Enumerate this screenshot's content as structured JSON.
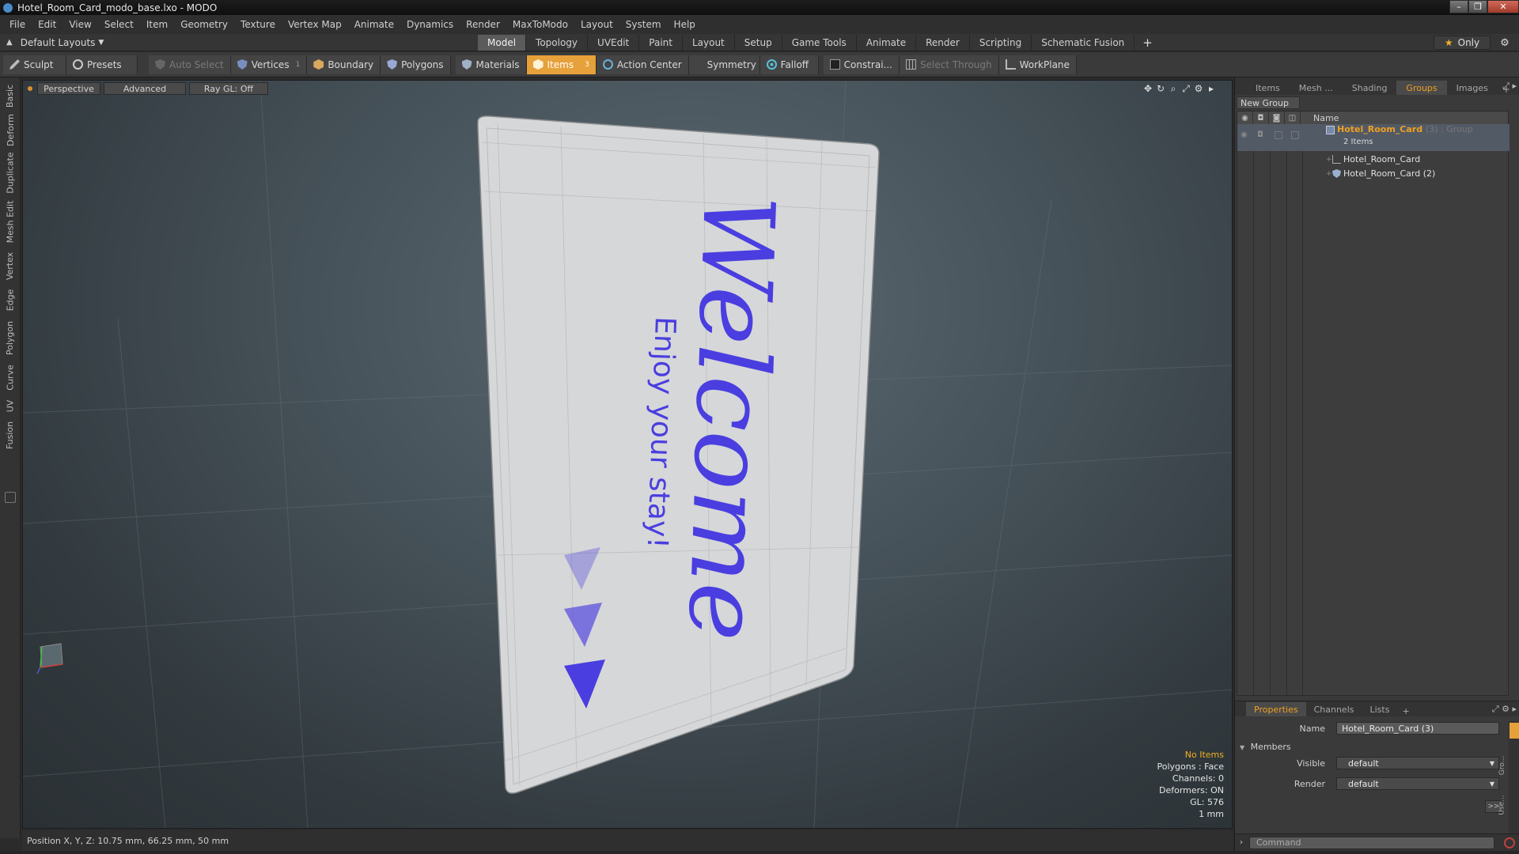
{
  "window": {
    "title": "Hotel_Room_Card_modo_base.lxo - MODO"
  },
  "menu": [
    "File",
    "Edit",
    "View",
    "Select",
    "Item",
    "Geometry",
    "Texture",
    "Vertex Map",
    "Animate",
    "Dynamics",
    "Render",
    "MaxToModo",
    "Layout",
    "System",
    "Help"
  ],
  "layout": {
    "default_layouts": "Default Layouts",
    "mode_tabs": [
      "Model",
      "Topology",
      "UVEdit",
      "Paint",
      "Layout",
      "Setup",
      "Game Tools",
      "Animate",
      "Render",
      "Scripting",
      "Schematic Fusion"
    ],
    "active_tab": "Model",
    "plus": "+",
    "only": "Only"
  },
  "toolbar": {
    "sculpt": "Sculpt",
    "presets": "Presets",
    "auto_select": "Auto Select",
    "vertices": "Vertices",
    "vertices_count": "1",
    "boundary": "Boundary",
    "polygons": "Polygons",
    "materials": "Materials",
    "items": "Items",
    "items_count": "3",
    "action_center": "Action Center",
    "symmetry": "Symmetry",
    "falloff": "Falloff",
    "constraints": "Constrai...",
    "select_through": "Select Through",
    "workplane": "WorkPlane"
  },
  "left_tabs": [
    "Basic",
    "Deform",
    "Duplicate",
    "Mesh Edit",
    "Vertex",
    "Edge",
    "Polygon",
    "Curve",
    "UV",
    "Fusion"
  ],
  "viewport": {
    "view": "Perspective",
    "shading": "Advanced",
    "raygl": "Ray GL: Off",
    "card_title": "Welcome",
    "card_subtitle": "Enjoy your stay!",
    "accent_color": "#4a3ee0",
    "info": {
      "no_items": "No Items",
      "polygons": "Polygons : Face",
      "channels": "Channels: 0",
      "deformers": "Deformers: ON",
      "gl": "GL: 576",
      "scale": "1 mm"
    }
  },
  "status": {
    "position": "Position X, Y, Z:  10.75 mm, 66.25 mm, 50 mm"
  },
  "right_panel": {
    "tabs": [
      "Items",
      "Mesh ...",
      "Shading",
      "Groups",
      "Images"
    ],
    "active_tab": "Groups",
    "new_group": "New Group",
    "name_column": "Name",
    "group": {
      "name": "Hotel_Room_Card",
      "suffix": "(3) : Group",
      "count": "2 Items",
      "children": [
        "Hotel_Room_Card",
        "Hotel_Room_Card (2)"
      ]
    }
  },
  "properties": {
    "tabs": [
      "Properties",
      "Channels",
      "Lists"
    ],
    "active_tab": "Properties",
    "name_label": "Name",
    "name_value": "Hotel_Room_Card (3)",
    "members": "Members",
    "visible_label": "Visible",
    "visible_value": "default",
    "render_label": "Render",
    "render_value": "default",
    "more": ">>",
    "side_labels": [
      "Gro...",
      "Use..."
    ],
    "command_placeholder": "Command"
  }
}
